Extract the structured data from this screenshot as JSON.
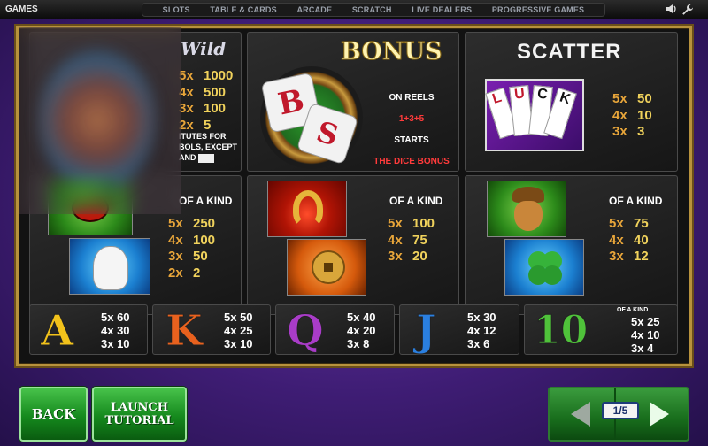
{
  "topbar": {
    "games_label": "GAMES",
    "nav": [
      "SLOTS",
      "TABLE & CARDS",
      "ARCADE",
      "SCRATCH",
      "LIVE DEALERS",
      "PROGRESSIVE GAMES"
    ],
    "sound_icon": "speaker-icon",
    "settings_icon": "wrench-icon"
  },
  "wild": {
    "logo": "Wild",
    "pays": [
      {
        "count": "5x",
        "pay": "1000"
      },
      {
        "count": "4x",
        "pay": "500"
      },
      {
        "count": "3x",
        "pay": "100"
      },
      {
        "count": "2x",
        "pay": "5"
      }
    ],
    "note_line1": "ITUTES FOR",
    "note_line2": "BOLS, EXCEPT",
    "note_line3": "AND"
  },
  "bonus": {
    "title": "BONUS",
    "dice_text": "BOS",
    "line1": "ON REELS",
    "reels": "1+3+5",
    "line3": "STARTS",
    "line4": "THE DICE BONUS"
  },
  "scatter": {
    "title": "SCATTER",
    "card_text": "LUCK",
    "pays": [
      {
        "count": "5x",
        "pay": "50"
      },
      {
        "count": "4x",
        "pay": "10"
      },
      {
        "count": "3x",
        "pay": "3"
      }
    ]
  },
  "mid_left": {
    "ofkind": "OF A KIND",
    "pays": [
      {
        "count": "5x",
        "pay": "250"
      },
      {
        "count": "4x",
        "pay": "100"
      },
      {
        "count": "3x",
        "pay": "50"
      },
      {
        "count": "2x",
        "pay": "2"
      }
    ]
  },
  "mid_center": {
    "ofkind": "OF A KIND",
    "pays": [
      {
        "count": "5x",
        "pay": "100"
      },
      {
        "count": "4x",
        "pay": "75"
      },
      {
        "count": "3x",
        "pay": "20"
      }
    ]
  },
  "mid_right": {
    "ofkind": "OF A KIND",
    "pays": [
      {
        "count": "5x",
        "pay": "75"
      },
      {
        "count": "4x",
        "pay": "40"
      },
      {
        "count": "3x",
        "pay": "12"
      }
    ]
  },
  "letters": [
    {
      "glyph": "A",
      "color": "#f2c21b",
      "pays": [
        "5x 60",
        "4x 30",
        "3x 10"
      ]
    },
    {
      "glyph": "K",
      "color": "#e8611e",
      "pays": [
        "5x 50",
        "4x 25",
        "3x 10"
      ]
    },
    {
      "glyph": "Q",
      "color": "#a93cc8",
      "pays": [
        "5x 40",
        "4x 20",
        "3x 8"
      ]
    },
    {
      "glyph": "J",
      "color": "#2a7fe0",
      "pays": [
        "5x 30",
        "4x 12",
        "3x 6"
      ]
    }
  ],
  "ten": {
    "glyph": "10",
    "ofkind": "OF A KIND",
    "pays": [
      "5x 25",
      "4x 10",
      "3x 4"
    ]
  },
  "buttons": {
    "back": "BACK",
    "launch_line1": "LAUNCH",
    "launch_line2": "TUTORIAL",
    "page": "1/5"
  }
}
